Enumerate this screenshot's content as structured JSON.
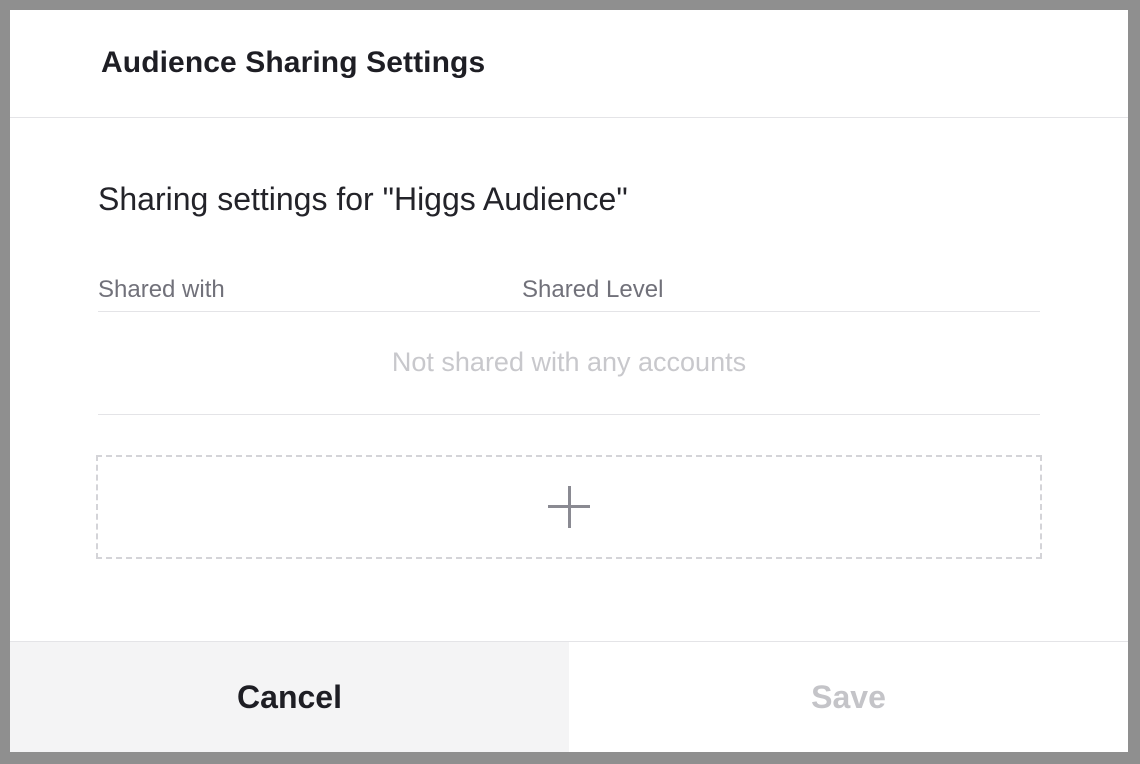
{
  "header": {
    "title": "Audience Sharing Settings"
  },
  "body": {
    "settings_title": "Sharing settings for \"Higgs Audience\"",
    "columns": {
      "shared_with": "Shared with",
      "shared_level": "Shared Level"
    },
    "empty_message": "Not shared with any accounts",
    "add_icon": "plus-icon"
  },
  "footer": {
    "cancel_label": "Cancel",
    "save_label": "Save",
    "save_disabled": true
  },
  "colors": {
    "backdrop": "#8f8f8f",
    "text_primary": "#1e1e24",
    "text_muted": "#71717a",
    "text_placeholder": "#c8c8cc",
    "cancel_bg": "#f4f4f5",
    "disabled_text": "#c4c4c8"
  }
}
